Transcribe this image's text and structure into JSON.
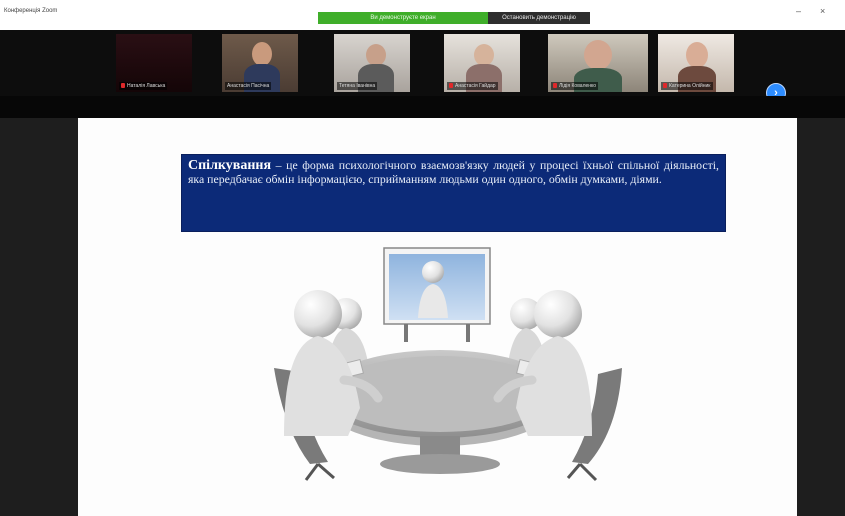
{
  "window": {
    "title": "Конференція Zoom",
    "share_banner": "Ви демонструєте екран",
    "stop_share_label": "Остановить демонстрацію"
  },
  "gallery": {
    "participants": [
      {
        "name": "Наталія Лавська"
      },
      {
        "name": "Анастасія Пасічна"
      },
      {
        "name": "Тетяна Іванівна"
      },
      {
        "name": "Анастасія Гайдар"
      },
      {
        "name": "Лідія Коваленко"
      },
      {
        "name": "Катерина Олійник"
      }
    ],
    "next_page_icon": "chevron-right-icon"
  },
  "slide": {
    "term": "Спілкування",
    "definition": " – це форма психологічного взаємозв'язку людей у процесі їхньої спільної діяльності, яка передбачає обмін інформацією, сприйманням людьми один одного, обмін думками, діями."
  },
  "colors": {
    "share_green": "#3fae2a",
    "box_blue": "#0c2a78",
    "accent_blue": "#2d8cff"
  }
}
